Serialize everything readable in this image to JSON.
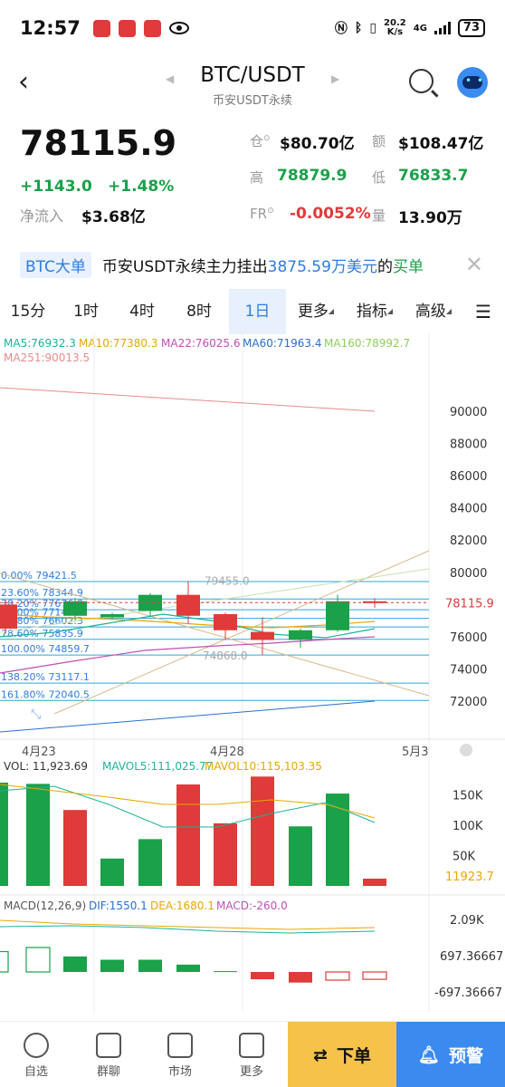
{
  "status": {
    "time": "12:57",
    "netspeed_value": "20.2",
    "netspeed_unit": "K/s",
    "network": "4G",
    "battery": "73"
  },
  "header": {
    "pair": "BTC/USDT",
    "subtitle": "币安USDT永续"
  },
  "quote": {
    "price": "78115.9",
    "change": "+1143.0",
    "change_pct": "+1.48%",
    "inflow_label": "净流入",
    "inflow_value": "3.68亿",
    "oi_label": "仓",
    "oi_value": "$80.70亿",
    "volume_amt_label": "额",
    "volume_amt_value": "$108.47亿",
    "high_label": "高",
    "high_value": "78879.9",
    "low_label": "低",
    "low_value": "76833.7",
    "fr_label": "FR",
    "fr_value": "-0.0052%",
    "qty_label": "量",
    "qty_value": "13.90万"
  },
  "banner": {
    "tag": "BTC大单",
    "text1": "币安USDT永续主力挂出",
    "amount": "3875.59万美元",
    "text2": "的",
    "side": "买单"
  },
  "tabs": [
    {
      "label": "15分"
    },
    {
      "label": "1时"
    },
    {
      "label": "4时"
    },
    {
      "label": "8时"
    },
    {
      "label": "1日"
    },
    {
      "label": "更多"
    },
    {
      "label": "指标"
    },
    {
      "label": "高级"
    }
  ],
  "ma_legend": {
    "ma5": "MA5:76932.3",
    "ma10": "MA10:77380.3",
    "ma22": "MA22:76025.6",
    "ma60": "MA60:71963.4",
    "ma160": "MA160:78992.7",
    "ma251": "MA251:90013.5"
  },
  "colors": {
    "up": "#1aa14a",
    "down": "#e03a3a",
    "accent": "#2f7de1",
    "ma5": "#1bb39a",
    "ma10": "#e8a800",
    "ma22": "#c04fb5",
    "ma60": "#2a6fd0",
    "ma160": "#8fcf5a",
    "ma251": "#e98b8b"
  },
  "price_axis": [
    "90000",
    "88000",
    "86000",
    "84000",
    "82000",
    "80000",
    "78115.9",
    "76000",
    "74000",
    "72000"
  ],
  "fib_levels": [
    "0.00% 79421.5",
    "23.60% 78344.9",
    "38.20% 77676.8",
    "50.00% 77140.1",
    "61.80% 76602.3",
    "78.60% 75835.9",
    "100.00% 74859.7",
    "138.20% 73117.1",
    "161.80% 72040.5"
  ],
  "annotations": {
    "high": "79455.0",
    "low": "74868.0"
  },
  "date_labels": [
    "4月23",
    "4月28",
    "5月3"
  ],
  "vol_legend": {
    "vol": "VOL: 11,923.69",
    "mavol5": "MAVOL5:111,025.77",
    "mavol10": "MAVOL10:115,103.35"
  },
  "vol_axis": [
    "150K",
    "100K",
    "50K",
    "11923.7"
  ],
  "macd_legend": {
    "params": "MACD(12,26,9)",
    "dif": "DIF:1550.1",
    "dea": "DEA:1680.1",
    "macd": "MACD:-260.0"
  },
  "macd_axis": [
    "2.09K",
    "697.36667",
    "-697.36667"
  ],
  "chart_data": {
    "type": "candlestick",
    "title": "",
    "candles": [
      {
        "o": 78000,
        "c": 76500,
        "h": 78300,
        "l": 76200
      },
      {
        "o": 77300,
        "c": 78200,
        "h": 78400,
        "l": 77000
      },
      {
        "o": 77200,
        "c": 77400,
        "h": 77500,
        "l": 77100
      },
      {
        "o": 77600,
        "c": 78600,
        "h": 78700,
        "l": 77200
      },
      {
        "o": 78600,
        "c": 77300,
        "h": 79455,
        "l": 76800
      },
      {
        "o": 77400,
        "c": 76400,
        "h": 77500,
        "l": 75800
      },
      {
        "o": 76300,
        "c": 75800,
        "h": 77200,
        "l": 74868
      },
      {
        "o": 75800,
        "c": 76400,
        "h": 76500,
        "l": 75300
      },
      {
        "o": 76400,
        "c": 78200,
        "h": 78600,
        "l": 76300
      },
      {
        "o": 78200,
        "c": 78116,
        "h": 78400,
        "l": 77800
      }
    ],
    "volume": [
      {
        "v": 170000,
        "up": true
      },
      {
        "v": 168000,
        "up": true
      },
      {
        "v": 125000,
        "up": false
      },
      {
        "v": 45000,
        "up": true
      },
      {
        "v": 77000,
        "up": true
      },
      {
        "v": 167000,
        "up": false
      },
      {
        "v": 103000,
        "up": false
      },
      {
        "v": 180000,
        "up": false
      },
      {
        "v": 98000,
        "up": true
      },
      {
        "v": 152000,
        "up": true
      },
      {
        "v": 11924,
        "up": false
      }
    ],
    "macd_hist": [
      500,
      600,
      380,
      300,
      300,
      180,
      20,
      -180,
      -260,
      -200,
      -180
    ],
    "ylim": [
      71000,
      91000
    ]
  },
  "bottom_nav": [
    {
      "label": "自选"
    },
    {
      "label": "群聊"
    },
    {
      "label": "市场"
    },
    {
      "label": "更多"
    }
  ],
  "order_label": "下单",
  "alert_label": "预警"
}
